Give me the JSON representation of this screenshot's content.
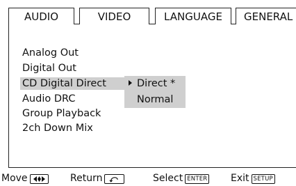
{
  "tabs": [
    {
      "label": "AUDIO",
      "active": true
    },
    {
      "label": "VIDEO",
      "active": false
    },
    {
      "label": "LANGUAGE",
      "active": false
    },
    {
      "label": "GENERAL",
      "active": false
    }
  ],
  "menu": {
    "items": [
      {
        "label": "Analog Out"
      },
      {
        "label": "Digital Out"
      },
      {
        "label": "CD Digital Direct",
        "highlighted": true
      },
      {
        "label": "Audio DRC"
      },
      {
        "label": "Group Playback"
      },
      {
        "label": "2ch Down Mix"
      }
    ],
    "submenu": {
      "options": [
        {
          "label": "Direct *",
          "selected": true
        },
        {
          "label": "Normal",
          "selected": false
        }
      ]
    }
  },
  "footer": {
    "move_label": "Move",
    "return_label": "Return",
    "select_label": "Select",
    "select_key": "ENTER",
    "exit_label": "Exit",
    "exit_key": "SETUP",
    "move_icon": "left-right-arrows-icon",
    "return_icon": "return-arrow-icon"
  },
  "colors": {
    "highlight": "#cfcfcf",
    "text": "#111111",
    "background": "#ffffff"
  }
}
